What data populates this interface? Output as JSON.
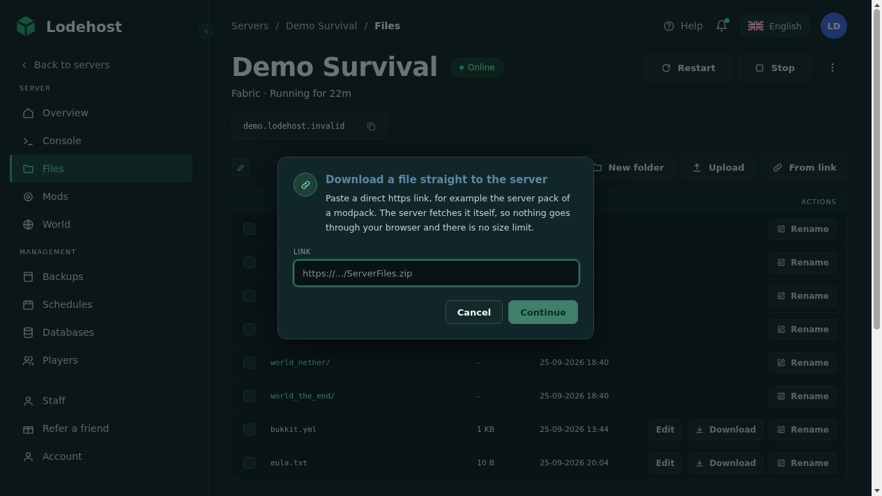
{
  "sidebar": {
    "brand": "Lodehost",
    "back_link": "Back to servers",
    "sections": [
      {
        "heading": "SERVER",
        "items": [
          {
            "label": "Overview",
            "selected": false
          },
          {
            "label": "Console",
            "selected": false
          },
          {
            "label": "Files",
            "selected": true
          },
          {
            "label": "Mods",
            "selected": false
          },
          {
            "label": "World",
            "selected": false
          }
        ]
      },
      {
        "heading": "MANAGEMENT",
        "items": [
          {
            "label": "Backups",
            "selected": false
          },
          {
            "label": "Schedules",
            "selected": false
          },
          {
            "label": "Databases",
            "selected": false
          },
          {
            "label": "Players",
            "selected": false
          }
        ]
      },
      {
        "items": [
          {
            "label": "Staff",
            "selected": false
          },
          {
            "label": "Refer a friend",
            "selected": false
          },
          {
            "label": "Account",
            "selected": false
          }
        ]
      }
    ]
  },
  "breadcrumb": {
    "separator": "/",
    "items": [
      "Servers",
      "Demo Survival",
      "Files"
    ]
  },
  "header": {
    "help": "Help",
    "language": "English",
    "avatar": "LD"
  },
  "server": {
    "title": "Demo Survival",
    "status": "Online",
    "subtitle": "Fabric · Running for 22m",
    "address": "demo.lodehost.invalid",
    "actions": [
      "Restart",
      "Stop"
    ]
  },
  "toolbar": [
    "New folder",
    "Upload",
    "From link"
  ],
  "table": {
    "columns": [
      {
        "label": "ACTIONS"
      }
    ],
    "rows": [
      {
        "kind": "hidden",
        "checked": false,
        "actions": [
          "Rename"
        ]
      },
      {
        "kind": "hidden",
        "checked": false,
        "actions": [
          "Rename"
        ]
      },
      {
        "kind": "hidden",
        "checked": false,
        "actions": [
          "Rename"
        ]
      },
      {
        "kind": "hidden",
        "checked": false,
        "actions": [
          "Rename"
        ]
      },
      {
        "kind": "folder",
        "checked": false,
        "name": "world_nether/",
        "size": "-",
        "modified": "25-09-2026 18:40",
        "actions": [
          "Rename"
        ]
      },
      {
        "kind": "folder",
        "checked": false,
        "name": "world_the_end/",
        "size": "-",
        "modified": "25-09-2026 18:40",
        "actions": [
          "Rename"
        ]
      },
      {
        "kind": "file",
        "checked": false,
        "name": "bukkit.yml",
        "size": "1 KB",
        "modified": "25-09-2026 13:44",
        "actions": [
          "Edit",
          "Download",
          "Rename"
        ]
      },
      {
        "kind": "file",
        "checked": false,
        "name": "eula.txt",
        "size": "10 B",
        "modified": "25-09-2026 20:04",
        "actions": [
          "Edit",
          "Download",
          "Rename"
        ]
      }
    ]
  },
  "modal": {
    "title": "Download a file straight to the server",
    "description": "Paste a direct https link, for example the server pack of a modpack. The server fetches it itself, so nothing goes through your browser and there is no size limit.",
    "field_label": "LINK",
    "placeholder": "https://.../ServerFiles.zip",
    "buttons": [
      {
        "kind": "secondary",
        "label": "Cancel"
      },
      {
        "kind": "primary",
        "label": "Continue"
      }
    ]
  }
}
